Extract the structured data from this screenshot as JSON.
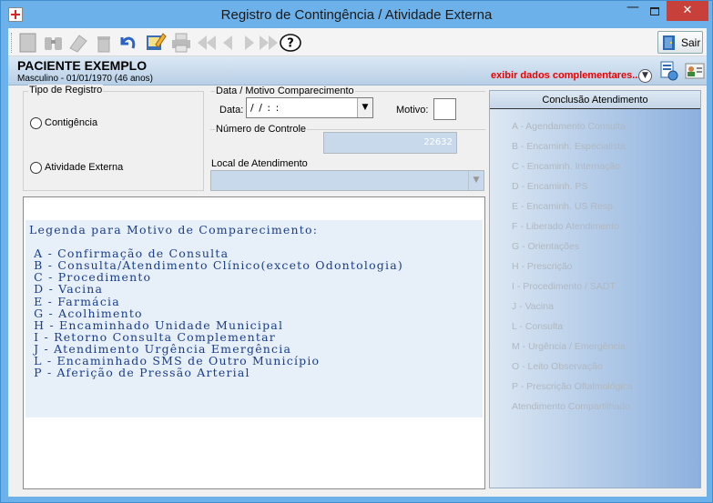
{
  "window": {
    "title": "Registro de Contingência / Atividade Externa",
    "minimize": "—",
    "close": "✕"
  },
  "toolbar": {
    "sair_label": "Sair",
    "icons": [
      "new-icon",
      "binoculars-icon",
      "eraser-icon",
      "trash-icon",
      "undo-icon",
      "edit-icon",
      "print-icon",
      "first-icon",
      "prev-icon",
      "next-icon",
      "last-icon",
      "help-icon"
    ]
  },
  "patient": {
    "name": "PACIENTE EXEMPLO",
    "info": "Masculino - 01/01/1970 (46 anos)",
    "exibir_label": "exibir dados complementares..."
  },
  "tipo_registro": {
    "label": "Tipo de Registro",
    "options": [
      "Contigência",
      "Atividade Externa"
    ]
  },
  "data_motivo": {
    "label": "Data / Motivo Comparecimento",
    "data_label": "Data:",
    "data_value": "/ /    : :",
    "motivo_label": "Motivo:",
    "motivo_value": ""
  },
  "numero_controle": {
    "label": "Número de Controle",
    "value": "22632"
  },
  "local_atendimento": {
    "label": "Local de Atendimento",
    "value": ""
  },
  "legenda": {
    "text": "Legenda para Motivo de Comparecimento:\n\n A - Confirmação de Consulta\n B - Consulta/Atendimento Clínico(exceto Odontologia)\n C - Procedimento\n D - Vacina\n E - Farmácia\n G - Acolhimento\n H - Encaminhado Unidade Municipal\n I - Retorno Consulta Complementar\n J - Atendimento Urgência Emergência\n L - Encaminhado SMS de Outro Município\n P - Aferição de Pressão Arterial"
  },
  "conclusao": {
    "title": "Conclusão Atendimento",
    "items": [
      "A - Agendamento Consulta",
      "B - Encaminh. Especialista",
      "C - Encaminh. Internação",
      "D - Encaminh. PS",
      "E - Encaminh. US Resp.",
      "F - Liberado Atendimento",
      "G - Orientações",
      "H - Prescrição",
      "I - Procedimento / SADT",
      "J - Vacina",
      "L - Consulta",
      "M - Urgência / Emergência",
      "O - Leito Observação",
      "P - Prescrição Oftalmológica",
      "Atendimento Compartilhado"
    ]
  },
  "colors": {
    "titlebar": "#6cb1e9",
    "close": "#c7403a",
    "legend_text": "#1a3d8c",
    "exibir": "#ee0000"
  }
}
